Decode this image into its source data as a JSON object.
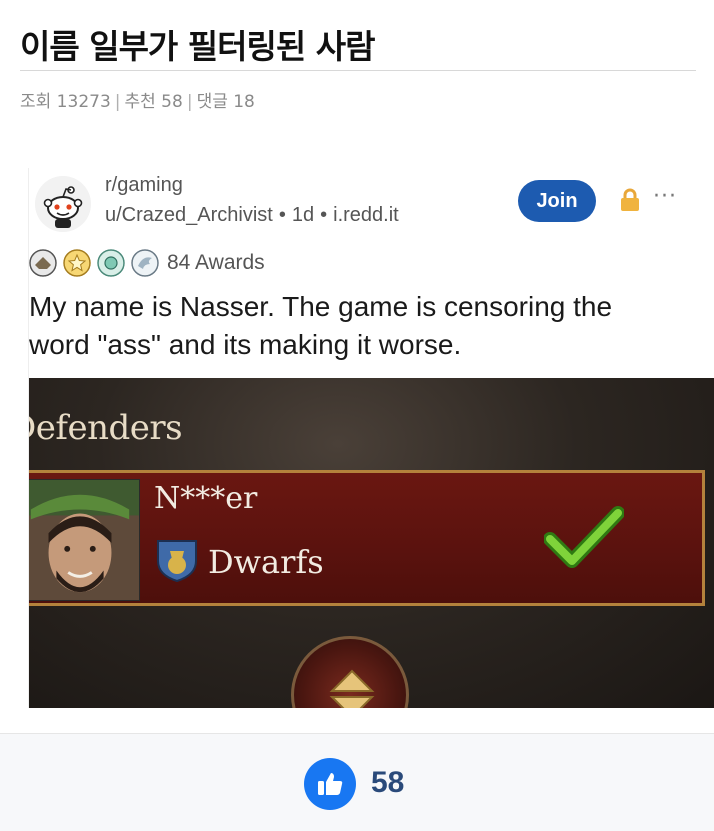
{
  "post": {
    "title": "이름 일부가 필터링된 사람",
    "views_label": "조회 13273",
    "recommend_label": "추천 58",
    "comments_label": "댓글 18",
    "separator": "|"
  },
  "reddit": {
    "subreddit": "r/gaming",
    "author": "u/Crazed_Archivist",
    "age": "1d",
    "domain": "i.redd.it",
    "dot": "•",
    "join_label": "Join",
    "more_label": "···",
    "awards_label": "84 Awards",
    "text": "My name is Nasser. The game is censoring the word \"ass\" and its making it worse."
  },
  "game": {
    "heading": "Defenders",
    "unit_name": "N***er",
    "faction": "Dwarfs"
  },
  "footer": {
    "like_count": "58",
    "accent_color": "#1877f2"
  }
}
